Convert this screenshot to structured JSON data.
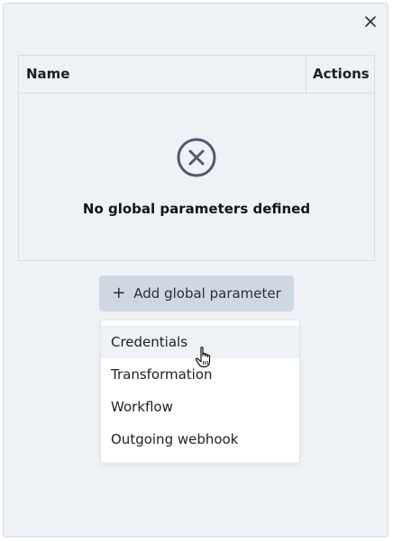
{
  "dialog": {
    "close_icon": "close-icon"
  },
  "table": {
    "columns": [
      "Name",
      "Actions"
    ],
    "empty_icon": "circle-x-icon",
    "empty_message": "No global parameters defined"
  },
  "add_button": {
    "icon": "plus-icon",
    "label": "Add global parameter"
  },
  "dropdown": {
    "items": [
      {
        "label": "Credentials",
        "hovered": true
      },
      {
        "label": "Transformation",
        "hovered": false
      },
      {
        "label": "Workflow",
        "hovered": false
      },
      {
        "label": "Outgoing webhook",
        "hovered": false
      }
    ]
  },
  "colors": {
    "panel_bg": "#eef2f7",
    "button_bg": "#cfd8e2",
    "icon_color": "#4f5b6a"
  }
}
